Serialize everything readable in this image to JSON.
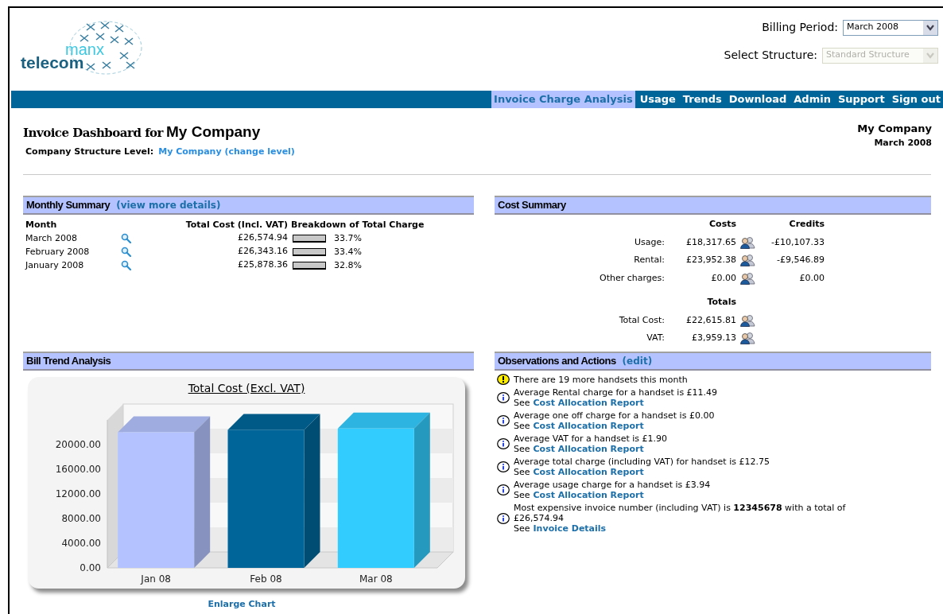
{
  "logo": {
    "top": "manx",
    "bottom": "telecom"
  },
  "billing_period": {
    "label": "Billing Period:",
    "value": "March 2008",
    "disabled": false
  },
  "structure": {
    "label": "Select Structure:",
    "value": "Standard Structure",
    "disabled": true
  },
  "nav": [
    {
      "label": "Invoice Charge Analysis",
      "selected": true
    },
    {
      "label": "Usage",
      "selected": false
    },
    {
      "label": "Trends",
      "selected": false
    },
    {
      "label": "Download",
      "selected": false
    },
    {
      "label": "Admin",
      "selected": false
    },
    {
      "label": "Support",
      "selected": false
    },
    {
      "label": "Sign out",
      "selected": false
    }
  ],
  "heading": {
    "prefix": "Invoice Dashboard for",
    "company": "My Company",
    "level_label": "Company Structure Level:",
    "level_link": "My Company (change level)"
  },
  "corner": {
    "company": "My Company",
    "period": "March 2008"
  },
  "monthly_summary": {
    "title": "Monthly Summary",
    "link": "(view more details)",
    "columns": [
      "Month",
      "Total Cost (Incl. VAT)",
      "Breakdown of Total Charge"
    ],
    "rows": [
      {
        "month": "March 2008",
        "total": "£26,574.94",
        "share": "33.7%"
      },
      {
        "month": "February 2008",
        "total": "£26,343.16",
        "share": "33.4%"
      },
      {
        "month": "January 2008",
        "total": "£25,878.36",
        "share": "32.8%"
      }
    ]
  },
  "cost_summary": {
    "title": "Cost Summary",
    "columns": [
      "Costs",
      "Credits"
    ],
    "rows": [
      {
        "label": "Usage:",
        "cost": "£18,317.65",
        "credit": "-£10,107.33"
      },
      {
        "label": "Rental:",
        "cost": "£23,952.38",
        "credit": "-£9,546.89"
      },
      {
        "label": "Other charges:",
        "cost": "£0.00",
        "credit": "£0.00"
      }
    ],
    "totals_heading": "Totals",
    "totals": [
      {
        "label": "Total Cost:",
        "cost": "£22,615.81"
      },
      {
        "label": "VAT:",
        "cost": "£3,959.13"
      }
    ]
  },
  "bill_trend": {
    "title": "Bill Trend Analysis",
    "link": "Enlarge Chart",
    "chart_data": {
      "type": "bar",
      "title": "Total Cost (Excl. VAT)",
      "categories": [
        "Jan 08",
        "Feb 08",
        "Mar 08"
      ],
      "series": [
        {
          "color": "#b4c3ff",
          "values": [
            22000,
            null,
            null
          ]
        },
        {
          "color": "#006699",
          "values": [
            null,
            22400,
            null
          ]
        },
        {
          "color": "#33ccff",
          "values": [
            null,
            null,
            22600
          ]
        }
      ],
      "ylim": [
        0,
        24000
      ],
      "yticks": [
        {
          "value": 0,
          "label": "0.00"
        },
        {
          "value": 4000,
          "label": "4000.00"
        },
        {
          "value": 8000,
          "label": "8000.00"
        },
        {
          "value": 12000,
          "label": "12000.00"
        },
        {
          "value": 16000,
          "label": "16000.00"
        },
        {
          "value": 20000,
          "label": "20000.00"
        }
      ]
    }
  },
  "observations": {
    "title": "Observations and Actions",
    "link": "(edit)",
    "items": [
      {
        "kind": "warning",
        "text": "There are 19 more handsets this month"
      },
      {
        "kind": "info",
        "text": "Average Rental charge for a handset is £11.49",
        "see": "See",
        "link": "Cost Allocation Report"
      },
      {
        "kind": "info",
        "text": "Average one off charge for a handset is £0.00",
        "see": "See",
        "link": "Cost Allocation Report"
      },
      {
        "kind": "info",
        "text": "Average VAT for a handset is £1.90",
        "see": "See",
        "link": "Cost Allocation Report"
      },
      {
        "kind": "info",
        "text": "Average total charge (including VAT) for handset is £12.75",
        "see": "See",
        "link": "Cost Allocation Report"
      },
      {
        "kind": "info",
        "text": "Average usage charge for a handset is £3.94",
        "see": "See",
        "link": "Cost Allocation Report"
      },
      {
        "kind": "info",
        "text": "Most expensive invoice number (including VAT) is **12345678** with a total of £26,574.94",
        "see": "See",
        "link": "Invoice Details"
      }
    ]
  }
}
